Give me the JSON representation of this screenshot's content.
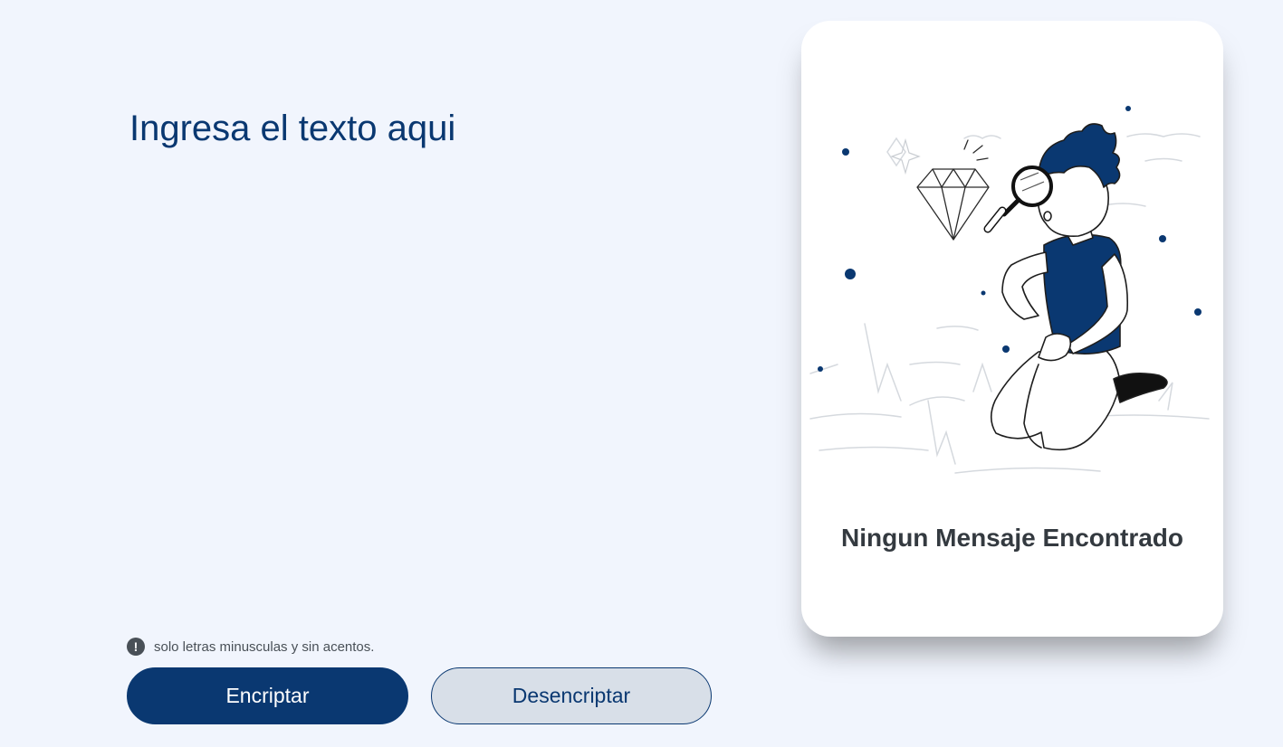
{
  "input": {
    "placeholder": "Ingresa el texto aqui"
  },
  "hint": {
    "icon": "exclamation-icon",
    "text": "solo letras minusculas y sin acentos."
  },
  "buttons": {
    "encrypt_label": "Encriptar",
    "decrypt_label": "Desencriptar"
  },
  "output_card": {
    "title": "Ningun Mensaje Encontrado",
    "illustration": "person-with-magnifying-glass-illustration"
  },
  "colors": {
    "background": "#f1f5fd",
    "primary": "#0a3871",
    "secondary_button": "#d8dfe8",
    "hint_text": "#495057",
    "card_title": "#343a40"
  }
}
